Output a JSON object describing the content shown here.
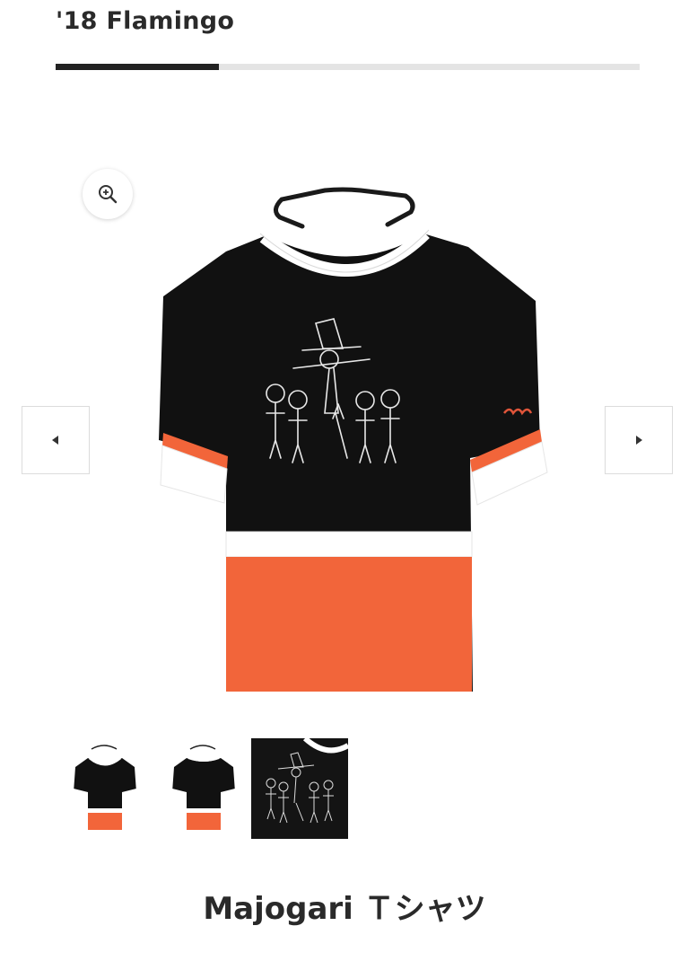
{
  "header": {
    "title": "'18 Flamingo"
  },
  "gallery": {
    "progress_fraction": 0.28,
    "zoom_icon": "zoom-in-icon",
    "prev_icon": "arrow-left-icon",
    "next_icon": "arrow-right-icon",
    "thumbnail_count": 3,
    "selected_thumbnail": 1
  },
  "product": {
    "title": "Majogari Ｔシャツ"
  },
  "colors": {
    "shirt_black": "#111111",
    "shirt_orange": "#f2653a",
    "shirt_white": "#ffffff",
    "progress_fill": "#222222",
    "progress_track": "#e4e4e4"
  }
}
